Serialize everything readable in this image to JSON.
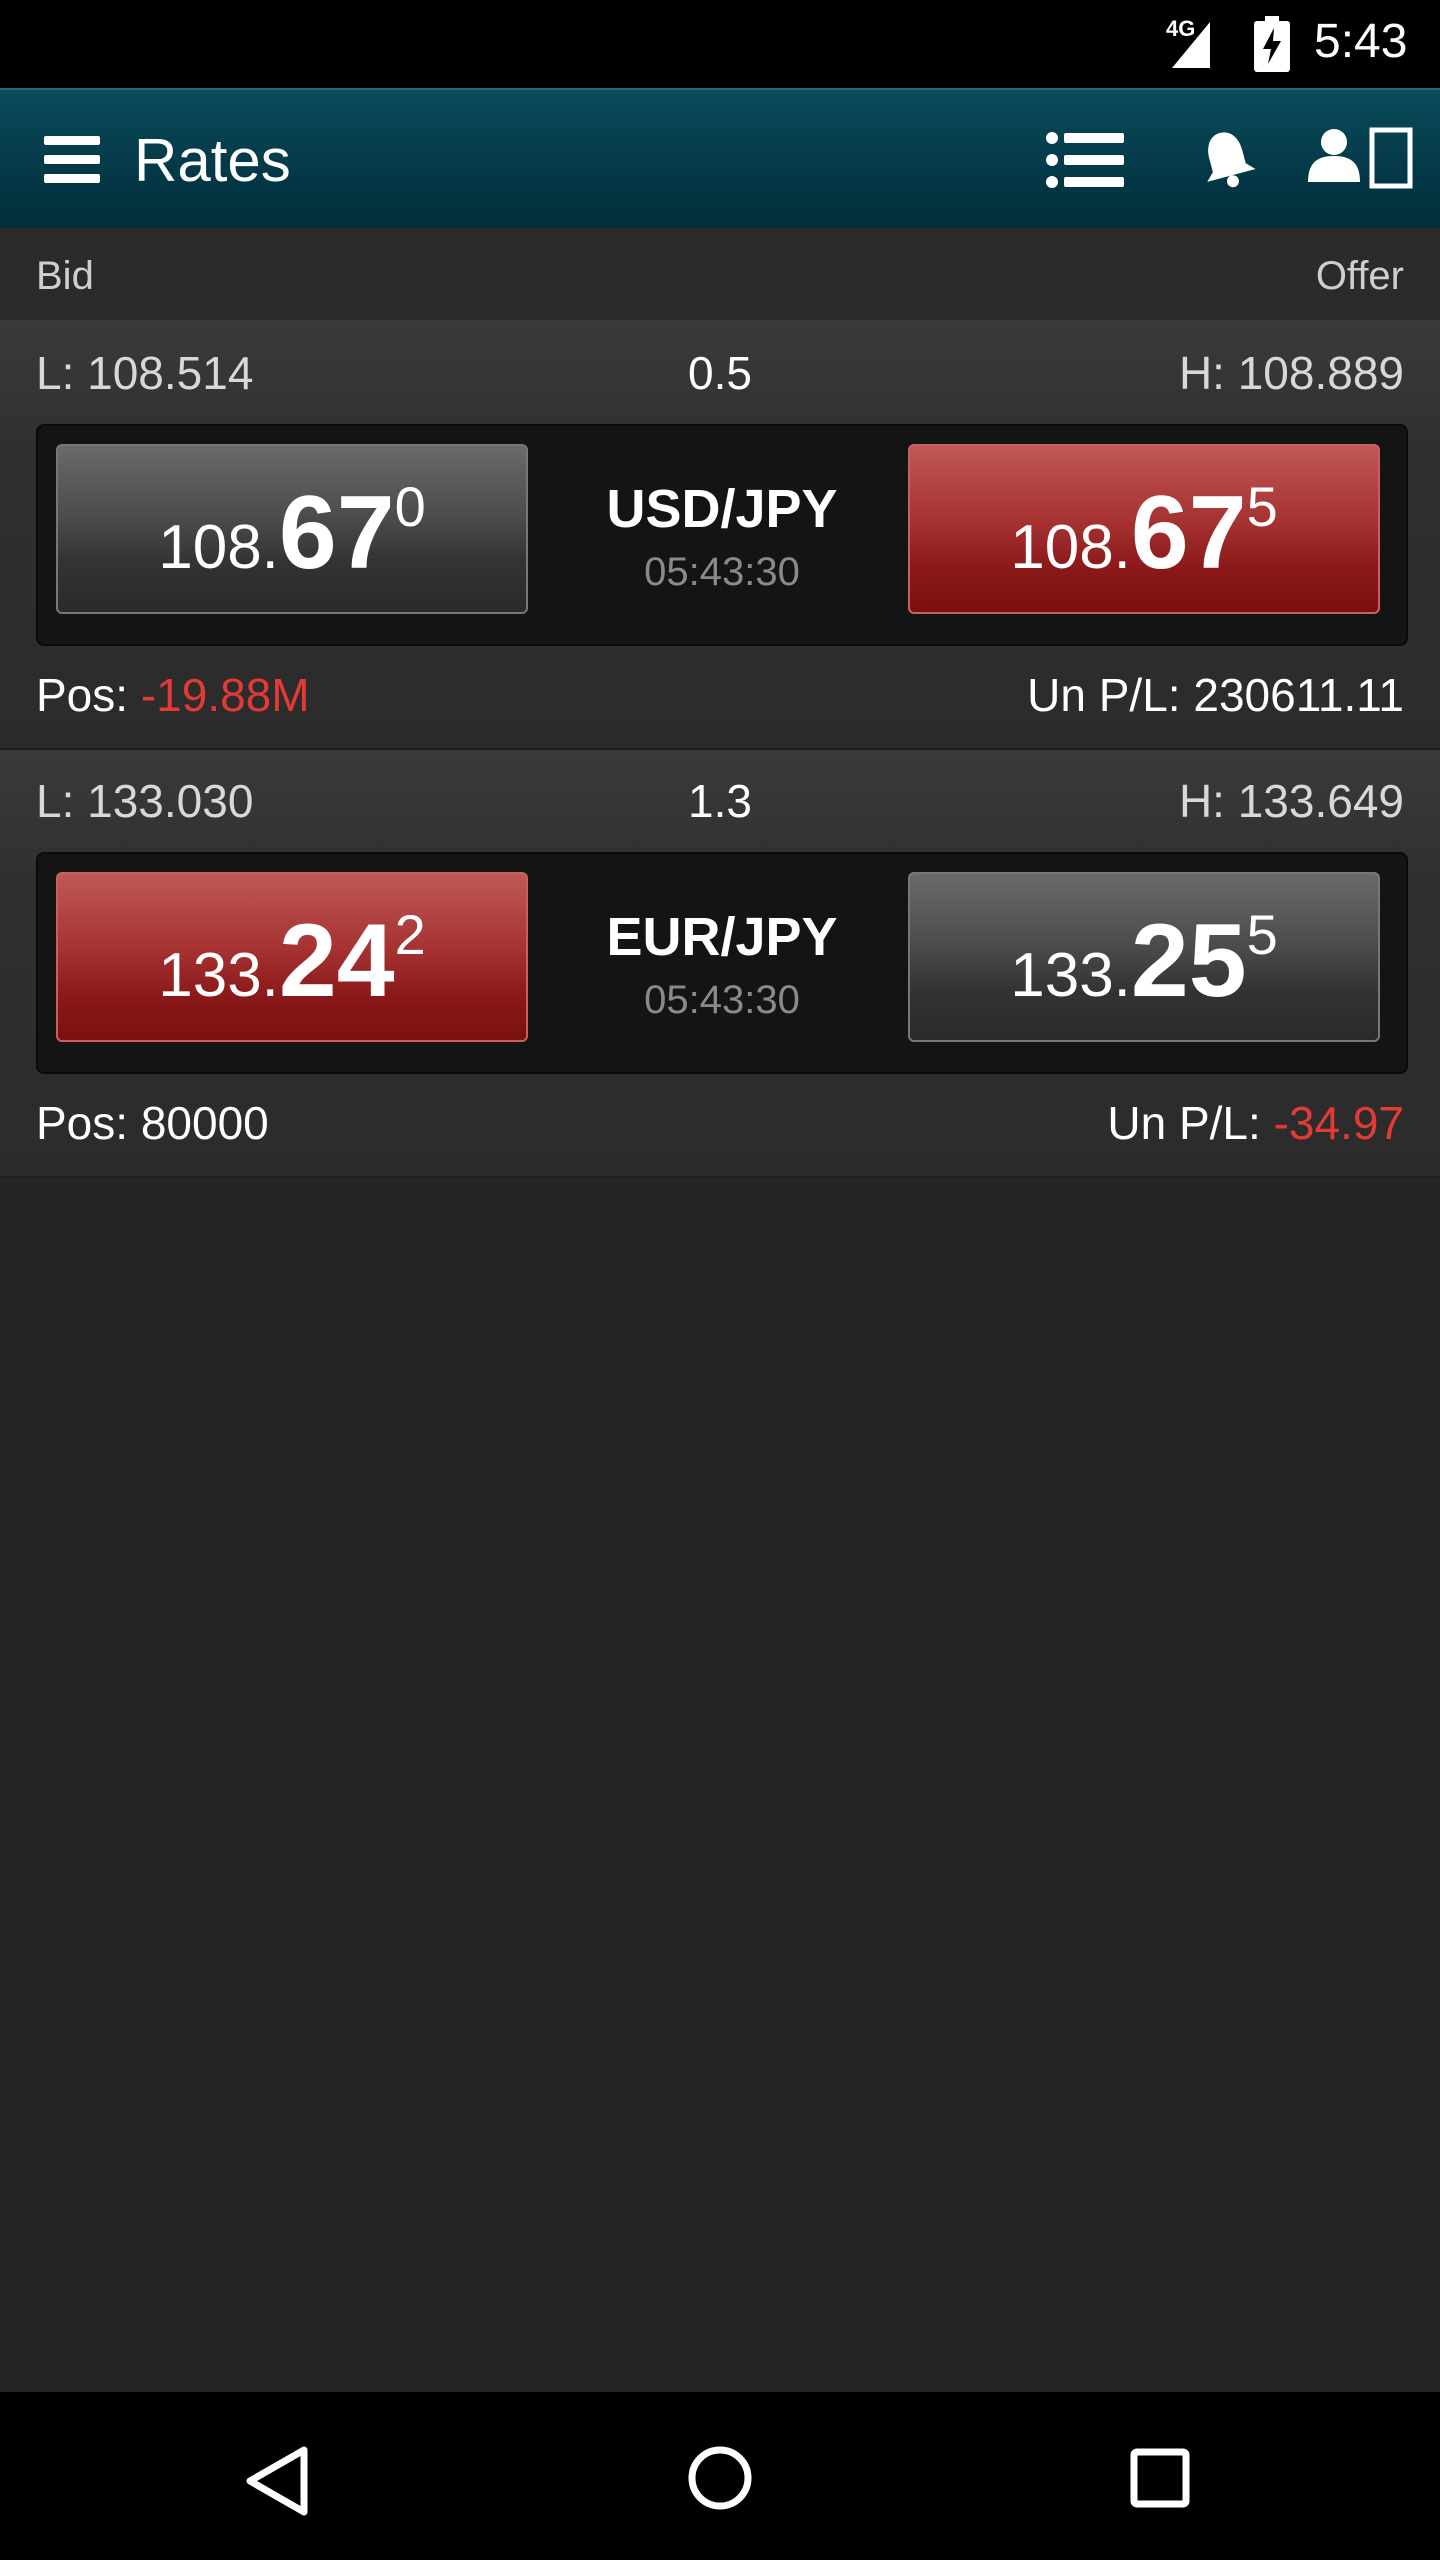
{
  "status_bar": {
    "network": "4G",
    "time": "5:43"
  },
  "app_bar": {
    "title": "Rates"
  },
  "header": {
    "bid_label": "Bid",
    "offer_label": "Offer"
  },
  "rates": [
    {
      "low": "L: 108.514",
      "spread": "0.5",
      "high": "H: 108.889",
      "pair": "USD/JPY",
      "time": "05:43:30",
      "bid": {
        "prefix": "108.",
        "big": "67",
        "pip": "0",
        "style": "gray"
      },
      "offer": {
        "prefix": "108.",
        "big": "67",
        "pip": "5",
        "style": "red"
      },
      "pos_label": "Pos: ",
      "pos_value": "-19.88M",
      "upl_label": "Un P/L: ",
      "upl_value": "230611.11"
    },
    {
      "low": "L: 133.030",
      "spread": "1.3",
      "high": "H: 133.649",
      "pair": "EUR/JPY",
      "time": "05:43:30",
      "bid": {
        "prefix": "133.",
        "big": "24",
        "pip": "2",
        "style": "red"
      },
      "offer": {
        "prefix": "133.",
        "big": "25",
        "pip": "5",
        "style": "gray"
      },
      "pos_label": "Pos: ",
      "pos_value": "80000",
      "upl_label": "Un P/L: ",
      "upl_value": "-34.97"
    }
  ],
  "colors": {
    "negative": "#e23a35",
    "appbar": "#033847",
    "background": "#252525"
  }
}
